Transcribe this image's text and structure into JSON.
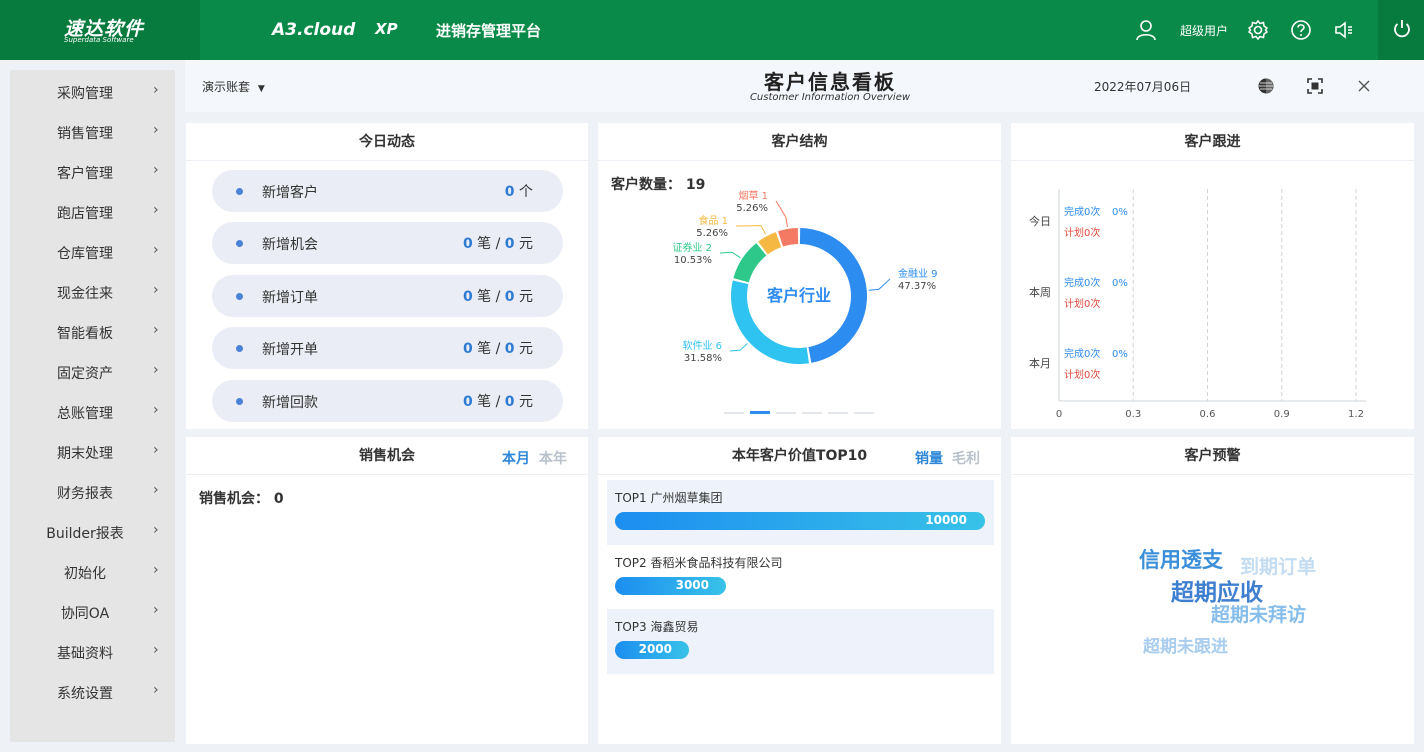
{
  "topbar": {
    "logo": "速达软件",
    "logo_sub": "Superdata Software",
    "product": "A3.cloud",
    "edition": "XP",
    "platform": "进销存管理平台",
    "user": "超级用户"
  },
  "sidebar": {
    "items": [
      {
        "label": "采购管理"
      },
      {
        "label": "销售管理"
      },
      {
        "label": "客户管理"
      },
      {
        "label": "跑店管理"
      },
      {
        "label": "仓库管理"
      },
      {
        "label": "现金往来"
      },
      {
        "label": "智能看板"
      },
      {
        "label": "固定资产"
      },
      {
        "label": "总账管理"
      },
      {
        "label": "期末处理"
      },
      {
        "label": "财务报表"
      },
      {
        "label": "Builder报表"
      },
      {
        "label": "初始化"
      },
      {
        "label": "协同OA"
      },
      {
        "label": "基础资料"
      },
      {
        "label": "系统设置"
      }
    ],
    "arrow": "›"
  },
  "header": {
    "account": "演示账套",
    "title": "客户信息看板",
    "subtitle": "Customer Information Overview",
    "date": "2022年07月06日"
  },
  "today": {
    "title": "今日动态",
    "rows": [
      {
        "label": "新增客户",
        "count": "0",
        "unit": "个"
      },
      {
        "label": "新增机会",
        "count": "0",
        "unit": "笔",
        "amount": "0",
        "amount_unit": "元"
      },
      {
        "label": "新增订单",
        "count": "0",
        "unit": "笔",
        "amount": "0",
        "amount_unit": "元"
      },
      {
        "label": "新增开单",
        "count": "0",
        "unit": "笔",
        "amount": "0",
        "amount_unit": "元"
      },
      {
        "label": "新增回款",
        "count": "0",
        "unit": "笔",
        "amount": "0",
        "amount_unit": "元"
      }
    ]
  },
  "structure": {
    "title": "客户结构",
    "count_label": "客户数量：",
    "count": "19",
    "center_label": "客户行业",
    "slices": [
      {
        "name": "金融业",
        "count": "9",
        "percent": "47.37%",
        "value": 9,
        "color": "#2d8cf0"
      },
      {
        "name": "软件业",
        "count": "6",
        "percent": "31.58%",
        "value": 6,
        "color": "#2ec3f0"
      },
      {
        "name": "证券业",
        "count": "2",
        "percent": "10.53%",
        "value": 2,
        "color": "#2ec98a"
      },
      {
        "name": "食品",
        "count": "1",
        "percent": "5.26%",
        "value": 1,
        "color": "#f5b843"
      },
      {
        "name": "烟草",
        "count": "1",
        "percent": "5.26%",
        "value": 1,
        "color": "#f47a64"
      }
    ]
  },
  "followup": {
    "title": "客户跟进",
    "rows": [
      {
        "label": "今日",
        "done": "完成0次",
        "done_pct": "0%",
        "plan": "计划0次"
      },
      {
        "label": "本周",
        "done": "完成0次",
        "done_pct": "0%",
        "plan": "计划0次"
      },
      {
        "label": "本月",
        "done": "完成0次",
        "done_pct": "0%",
        "plan": "计划0次"
      }
    ],
    "ticks": [
      "0",
      "0.3",
      "0.6",
      "0.9",
      "1.2"
    ]
  },
  "chart_data": {
    "type": "bar",
    "categories": [
      "今日",
      "本周",
      "本月"
    ],
    "series": [
      {
        "name": "完成",
        "values": [
          0,
          0,
          0
        ]
      },
      {
        "name": "计划",
        "values": [
          0,
          0,
          0
        ]
      }
    ],
    "xlim": [
      0,
      1.2
    ],
    "orientation": "horizontal"
  },
  "opportunity": {
    "title": "销售机会",
    "tab_month": "本月",
    "tab_year": "本年",
    "count_label": "销售机会：",
    "count": "0"
  },
  "top10": {
    "title": "本年客户价值TOP10",
    "tab_sales": "销量",
    "tab_profit": "毛利",
    "items": [
      {
        "rank": "TOP1",
        "name": "广州烟草集团",
        "value": "10000",
        "ratio": 1.0
      },
      {
        "rank": "TOP2",
        "name": "香稻米食品科技有限公司",
        "value": "3000",
        "ratio": 0.3
      },
      {
        "rank": "TOP3",
        "name": "海鑫贸易",
        "value": "2000",
        "ratio": 0.2
      }
    ]
  },
  "warning": {
    "title": "客户预警",
    "words": [
      {
        "text": "信用透支",
        "color": "#3b8fd9"
      },
      {
        "text": "到期订单",
        "color": "#c3dcf2"
      },
      {
        "text": "超期应收",
        "color": "#3f7fd0"
      },
      {
        "text": "超期未拜访",
        "color": "#86bdea"
      },
      {
        "text": "超期未跟进",
        "color": "#a9cdee"
      }
    ]
  }
}
